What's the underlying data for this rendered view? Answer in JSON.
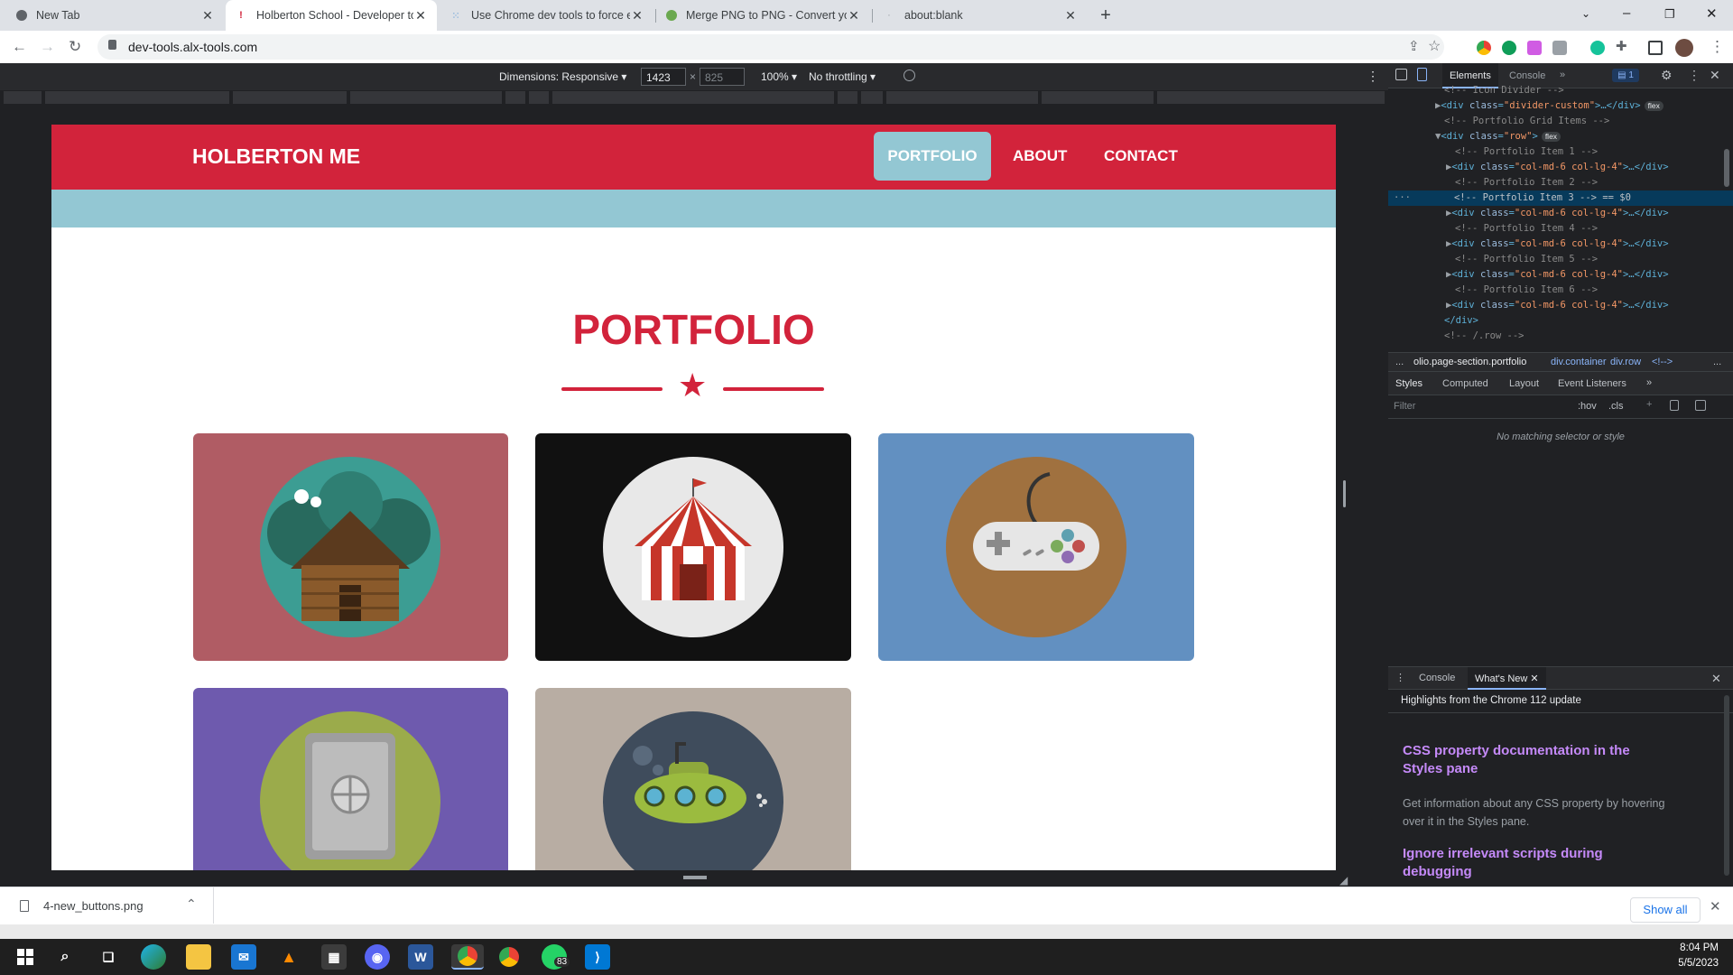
{
  "browser": {
    "tabs": [
      {
        "title": "New Tab"
      },
      {
        "title": "Holberton School - Developer to"
      },
      {
        "title": "Use Chrome dev tools to force el"
      },
      {
        "title": "Merge PNG to PNG - Convert yo"
      },
      {
        "title": "about:blank"
      }
    ],
    "url": "dev-tools.alx-tools.com"
  },
  "device_toolbar": {
    "dimensions_label": "Dimensions: Responsive",
    "width": "1423",
    "times": "×",
    "height": "825",
    "zoom": "100%",
    "throttling": "No throttling"
  },
  "site": {
    "brand": "HOLBERTON ME",
    "nav": [
      "PORTFOLIO",
      "ABOUT",
      "CONTACT"
    ],
    "section_title": "PORTFOLIO",
    "accent": "#d2233b",
    "band_color": "#93c7d3",
    "cards": [
      {
        "icon": "log-cabin-icon",
        "bg": "#b05c64"
      },
      {
        "icon": "circus-tent-icon",
        "bg": "#111111"
      },
      {
        "icon": "game-controller-icon",
        "bg": "#6290c1"
      },
      {
        "icon": "safe-icon",
        "bg": "#6e5aae"
      },
      {
        "icon": "submarine-icon",
        "bg": "#b8ada3"
      }
    ]
  },
  "devtools": {
    "top_tabs": [
      "Elements",
      "Console"
    ],
    "issues_count": "1",
    "dom_lines": [
      {
        "indent": 5,
        "kind": "comment",
        "text": "<!-- Icon Divider -->"
      },
      {
        "indent": 5,
        "kind": "elem",
        "arrow": "▶",
        "open": "<div ",
        "attr": "class",
        "val": "\"divider-custom\"",
        "close": ">…</div>",
        "badge": "flex"
      },
      {
        "indent": 5,
        "kind": "comment",
        "text": "<!-- Portfolio Grid Items -->"
      },
      {
        "indent": 5,
        "kind": "elem",
        "arrow": "▼",
        "open": "<div ",
        "attr": "class",
        "val": "\"row\"",
        "close": ">",
        "badge": "flex"
      },
      {
        "indent": 6,
        "kind": "comment",
        "text": "<!-- Portfolio Item 1 -->"
      },
      {
        "indent": 6,
        "kind": "elem",
        "arrow": "▶",
        "open": "<div ",
        "attr": "class",
        "val": "\"col-md-6 col-lg-4\"",
        "close": ">…</div>",
        "badge": ""
      },
      {
        "indent": 6,
        "kind": "comment",
        "text": "<!-- Portfolio Item 2 -->"
      },
      {
        "indent": 6,
        "kind": "selected",
        "text": "<!-- Portfolio Item 3 --> == $0"
      },
      {
        "indent": 6,
        "kind": "elem",
        "arrow": "▶",
        "open": "<div ",
        "attr": "class",
        "val": "\"col-md-6 col-lg-4\"",
        "close": ">…</div>",
        "badge": ""
      },
      {
        "indent": 6,
        "kind": "comment",
        "text": "<!-- Portfolio Item 4 -->"
      },
      {
        "indent": 6,
        "kind": "elem",
        "arrow": "▶",
        "open": "<div ",
        "attr": "class",
        "val": "\"col-md-6 col-lg-4\"",
        "close": ">…</div>",
        "badge": ""
      },
      {
        "indent": 6,
        "kind": "comment",
        "text": "<!-- Portfolio Item 5 -->"
      },
      {
        "indent": 6,
        "kind": "elem",
        "arrow": "▶",
        "open": "<div ",
        "attr": "class",
        "val": "\"col-md-6 col-lg-4\"",
        "close": ">…</div>",
        "badge": ""
      },
      {
        "indent": 6,
        "kind": "comment",
        "text": "<!-- Portfolio Item 6 -->"
      },
      {
        "indent": 6,
        "kind": "elem",
        "arrow": "▶",
        "open": "<div ",
        "attr": "class",
        "val": "\"col-md-6 col-lg-4\"",
        "close": ">…</div>",
        "badge": ""
      },
      {
        "indent": 5,
        "kind": "comment",
        "text": "</div>"
      },
      {
        "indent": 5,
        "kind": "comment",
        "text": "<!-- /.row -->"
      }
    ],
    "breadcrumbs": [
      "...",
      "olio.page-section.portfolio",
      "div.container",
      "div.row",
      "<!-->",
      "..."
    ],
    "style_tabs": [
      "Styles",
      "Computed",
      "Layout",
      "Event Listeners"
    ],
    "filter_placeholder": "Filter",
    "hov": ":hov",
    "cls": ".cls",
    "no_match": "No matching selector or style",
    "drawer_tabs": [
      "Console",
      "What's New"
    ],
    "whats_new_header": "Highlights from the Chrome 112 update",
    "articles": [
      {
        "title": "CSS property documentation in the Styles pane",
        "body": "Get information about any CSS property by hovering over it in the Styles pane."
      },
      {
        "title": "Ignore irrelevant scripts during debugging",
        "body": ""
      }
    ]
  },
  "download": {
    "file": "4-new_buttons.png",
    "show_all": "Show all"
  },
  "taskbar": {
    "time": "8:04 PM",
    "date": "5/5/2023",
    "whatsapp_badge": "83"
  }
}
